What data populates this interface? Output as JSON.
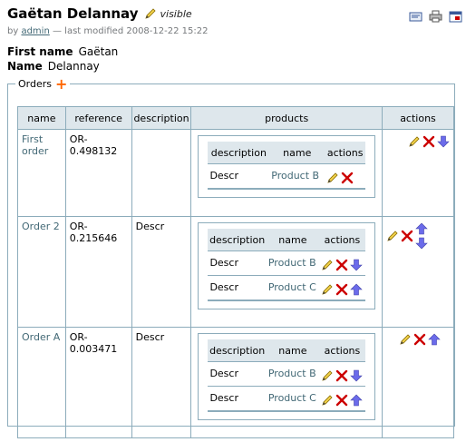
{
  "header": {
    "title": "Gaëtan Delannay",
    "state": "visible",
    "byline_prefix": "by",
    "author": "admin",
    "byline_suffix": "— last modified 2008-12-22 15:22"
  },
  "fields": [
    {
      "label": "First name",
      "value": "Gaëtan"
    },
    {
      "label": "Name",
      "value": "Delannay"
    }
  ],
  "orders": {
    "legend": "Orders",
    "add_icon": "plus-icon",
    "columns": [
      "name",
      "reference",
      "description",
      "products",
      "actions"
    ],
    "product_columns": [
      "description",
      "name",
      "actions"
    ],
    "rows": [
      {
        "name": "First order",
        "reference": "OR-0.498132",
        "description": "",
        "products": [
          {
            "description": "Descr",
            "name": "Product B"
          }
        ]
      },
      {
        "name": "Order 2",
        "reference": "OR-0.215646",
        "description": "Descr",
        "products": [
          {
            "description": "Descr",
            "name": "Product B"
          },
          {
            "description": "Descr",
            "name": "Product C"
          }
        ]
      },
      {
        "name": "Order A",
        "reference": "OR-0.003471",
        "description": "Descr",
        "products": [
          {
            "description": "Descr",
            "name": "Product B"
          },
          {
            "description": "Descr",
            "name": "Product C"
          }
        ]
      }
    ]
  },
  "icons": {
    "edit": "pencil-icon",
    "delete": "delete-x-icon",
    "up": "arrow-up-icon",
    "down": "arrow-down-icon",
    "send": "send-mail-icon",
    "print": "print-icon",
    "fullscreen": "fullscreen-icon"
  },
  "colors": {
    "link": "#436976",
    "border": "#8cacbb",
    "header_bg": "#dee7ec",
    "add": "#ff6600",
    "delete": "#cc0000",
    "arrow": "#6b6bea"
  }
}
